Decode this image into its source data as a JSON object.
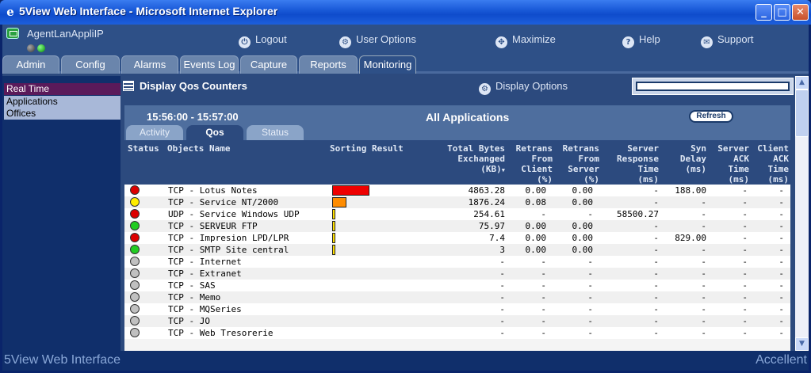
{
  "window": {
    "title": "5View Web Interface - Microsoft Internet Explorer",
    "min_glyph": "_",
    "max_glyph": "□",
    "close_glyph": "✕"
  },
  "header": {
    "agent_name": "AgentLanAppliIP",
    "links": [
      {
        "label": "Logout",
        "icon": "power-icon",
        "glyph": "⏻"
      },
      {
        "label": "User Options",
        "icon": "options-icon",
        "glyph": "⚙"
      },
      {
        "label": "Maximize",
        "icon": "maximize-icon",
        "glyph": "✥"
      },
      {
        "label": "Help",
        "icon": "help-icon",
        "glyph": "?"
      },
      {
        "label": "Support",
        "icon": "support-icon",
        "glyph": "✉"
      }
    ]
  },
  "tabs": [
    "Admin",
    "Config",
    "Alarms",
    "Events Log",
    "Capture",
    "Reports",
    "Monitoring"
  ],
  "active_tab": "Monitoring",
  "leftnav": {
    "items": [
      "Real Time",
      "Applications",
      "Offices"
    ],
    "selected": "Real Time"
  },
  "main": {
    "title": "Display Qos Counters",
    "display_options": "Display Options",
    "time_range": "15:56:00 - 15:57:00",
    "app_title": "All Applications",
    "refresh_label": "Refresh",
    "subtabs": [
      "Activity",
      "Qos",
      "Status"
    ],
    "active_subtab": "Qos"
  },
  "table": {
    "headers": {
      "status": "Status",
      "name": "Objects Name",
      "sorting": "Sorting Result",
      "total": [
        "Total Bytes",
        "Exchanged",
        "(KB)"
      ],
      "retrans_client": [
        "Retrans",
        "From",
        "Client",
        "(%)"
      ],
      "retrans_server": [
        "Retrans",
        "From",
        "Server",
        "(%)"
      ],
      "srt": [
        "Server",
        "Response",
        "Time",
        "(ms)"
      ],
      "syn": [
        "Syn",
        "Delay",
        "(ms)"
      ],
      "server_ack": [
        "Server",
        "ACK",
        "Time",
        "(ms)"
      ],
      "client_ack": [
        "Client",
        "ACK",
        "Time",
        "(ms)"
      ]
    },
    "sort_arrow": "▼",
    "rows": [
      {
        "status": "red",
        "name": "TCP - Lotus Notes",
        "bar": 1.0,
        "bar_color": "#ee0000",
        "total": "4863.28",
        "rc": "0.00",
        "rs": "0.00",
        "srt": "-",
        "syn": "188.00",
        "sack": "-",
        "cack": "-"
      },
      {
        "status": "yellow",
        "name": "TCP - Service NT/2000",
        "bar": 0.386,
        "bar_color": "#ff8c00",
        "total": "1876.24",
        "rc": "0.08",
        "rs": "0.00",
        "srt": "-",
        "syn": "-",
        "sack": "-",
        "cack": "-"
      },
      {
        "status": "red",
        "name": "UDP - Service Windows UDP",
        "bar": 0.052,
        "bar_color": "#ffe000",
        "total": "254.61",
        "rc": "-",
        "rs": "-",
        "srt": "58500.27",
        "syn": "-",
        "sack": "-",
        "cack": "-"
      },
      {
        "status": "green",
        "name": "TCP - SERVEUR FTP",
        "bar": 0.016,
        "bar_color": "#ffe000",
        "total": "75.97",
        "rc": "0.00",
        "rs": "0.00",
        "srt": "-",
        "syn": "-",
        "sack": "-",
        "cack": "-"
      },
      {
        "status": "red",
        "name": "TCP - Impresion LPD/LPR",
        "bar": 0.002,
        "bar_color": "#ffe000",
        "total": "7.4",
        "rc": "0.00",
        "rs": "0.00",
        "srt": "-",
        "syn": "829.00",
        "sack": "-",
        "cack": "-"
      },
      {
        "status": "green",
        "name": "TCP - SMTP Site central",
        "bar": 0.001,
        "bar_color": "#ffe000",
        "total": "3",
        "rc": "0.00",
        "rs": "0.00",
        "srt": "-",
        "syn": "-",
        "sack": "-",
        "cack": "-"
      },
      {
        "status": "gray",
        "name": "TCP - Internet",
        "bar": 0,
        "bar_color": "",
        "total": "-",
        "rc": "-",
        "rs": "-",
        "srt": "-",
        "syn": "-",
        "sack": "-",
        "cack": "-"
      },
      {
        "status": "gray",
        "name": "TCP - Extranet",
        "bar": 0,
        "bar_color": "",
        "total": "-",
        "rc": "-",
        "rs": "-",
        "srt": "-",
        "syn": "-",
        "sack": "-",
        "cack": "-"
      },
      {
        "status": "gray",
        "name": "TCP - SAS",
        "bar": 0,
        "bar_color": "",
        "total": "-",
        "rc": "-",
        "rs": "-",
        "srt": "-",
        "syn": "-",
        "sack": "-",
        "cack": "-"
      },
      {
        "status": "gray",
        "name": "TCP - Memo",
        "bar": 0,
        "bar_color": "",
        "total": "-",
        "rc": "-",
        "rs": "-",
        "srt": "-",
        "syn": "-",
        "sack": "-",
        "cack": "-"
      },
      {
        "status": "gray",
        "name": "TCP - MQSeries",
        "bar": 0,
        "bar_color": "",
        "total": "-",
        "rc": "-",
        "rs": "-",
        "srt": "-",
        "syn": "-",
        "sack": "-",
        "cack": "-"
      },
      {
        "status": "gray",
        "name": "TCP - JO",
        "bar": 0,
        "bar_color": "",
        "total": "-",
        "rc": "-",
        "rs": "-",
        "srt": "-",
        "syn": "-",
        "sack": "-",
        "cack": "-"
      },
      {
        "status": "gray",
        "name": "TCP - Web Tresorerie",
        "bar": 0,
        "bar_color": "",
        "total": "-",
        "rc": "-",
        "rs": "-",
        "srt": "-",
        "syn": "-",
        "sack": "-",
        "cack": "-"
      }
    ]
  },
  "scrollbar": {
    "up_glyph": "▲",
    "down_glyph": "▼"
  },
  "status_colors": {
    "red": "#dd0000",
    "yellow": "#ffee00",
    "green": "#22cc22",
    "gray": "#c0c0c0"
  },
  "footer": {
    "left": "5View Web Interface",
    "right": "Accellent"
  }
}
